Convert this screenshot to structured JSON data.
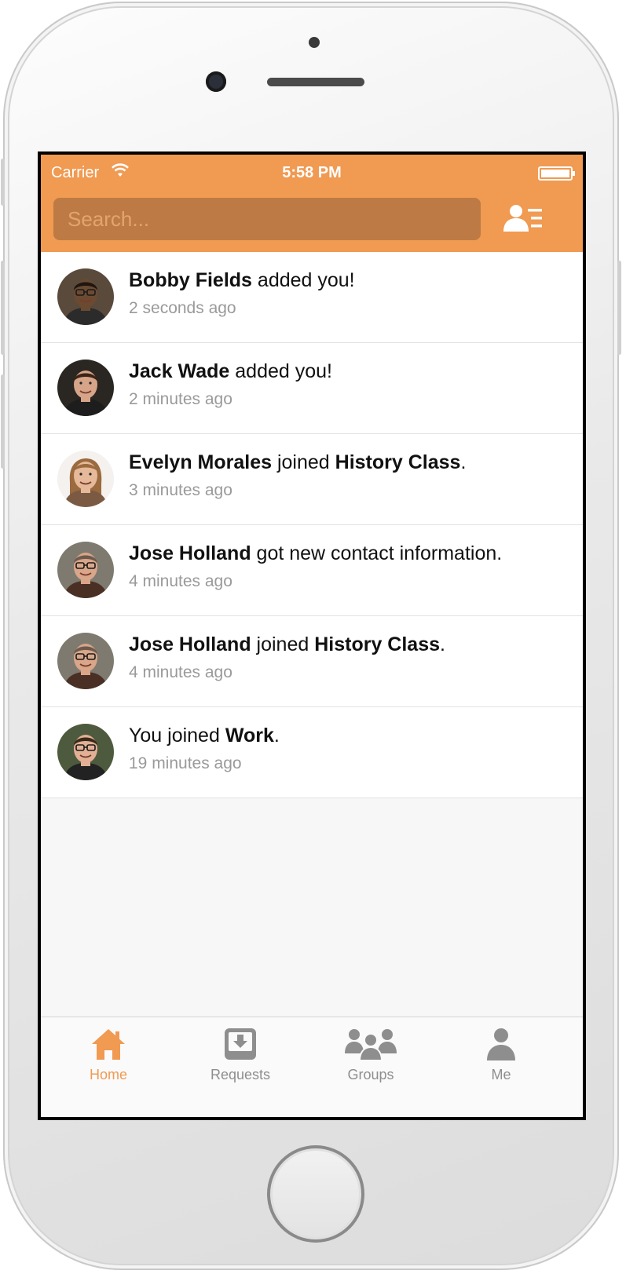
{
  "status_bar": {
    "carrier": "Carrier",
    "time": "5:58 PM"
  },
  "search": {
    "placeholder": "Search..."
  },
  "feed": [
    {
      "parts": [
        {
          "t": "Bobby Fields",
          "b": true
        },
        {
          "t": " added you!",
          "b": false
        }
      ],
      "time": "2 seconds ago",
      "avatar": "avatar-bobby-fields"
    },
    {
      "parts": [
        {
          "t": "Jack Wade",
          "b": true
        },
        {
          "t": " added you!",
          "b": false
        }
      ],
      "time": "2 minutes ago",
      "avatar": "avatar-jack-wade"
    },
    {
      "parts": [
        {
          "t": "Evelyn Morales",
          "b": true
        },
        {
          "t": " joined ",
          "b": false
        },
        {
          "t": "History Class",
          "b": true
        },
        {
          "t": ".",
          "b": false
        }
      ],
      "time": "3 minutes ago",
      "avatar": "avatar-evelyn-morales"
    },
    {
      "parts": [
        {
          "t": "Jose Holland",
          "b": true
        },
        {
          "t": " got new contact information.",
          "b": false
        }
      ],
      "time": "4 minutes ago",
      "avatar": "avatar-jose-holland"
    },
    {
      "parts": [
        {
          "t": "Jose Holland",
          "b": true
        },
        {
          "t": " joined ",
          "b": false
        },
        {
          "t": "History Class",
          "b": true
        },
        {
          "t": ".",
          "b": false
        }
      ],
      "time": "4 minutes ago",
      "avatar": "avatar-jose-holland"
    },
    {
      "parts": [
        {
          "t": "You joined ",
          "b": false
        },
        {
          "t": "Work",
          "b": true
        },
        {
          "t": ".",
          "b": false
        }
      ],
      "time": "19 minutes ago",
      "avatar": "avatar-you"
    }
  ],
  "tabs": [
    {
      "label": "Home",
      "icon": "home-icon",
      "active": true
    },
    {
      "label": "Requests",
      "icon": "requests-icon",
      "active": false
    },
    {
      "label": "Groups",
      "icon": "groups-icon",
      "active": false
    },
    {
      "label": "Me",
      "icon": "me-icon",
      "active": false
    }
  ],
  "colors": {
    "accent": "#f09a52",
    "search_bg": "#be7a44",
    "inactive_tab": "#8e8e8e"
  }
}
